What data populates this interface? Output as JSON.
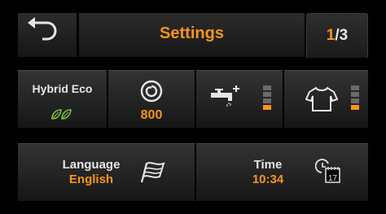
{
  "header": {
    "title": "Settings",
    "page_current": "1",
    "page_separator": "/",
    "page_total": "3"
  },
  "tiles": {
    "program": {
      "label": "Hybrid Eco",
      "icon": "leaf-icon",
      "accent": "#7bc043"
    },
    "spin": {
      "value": "800",
      "icon": "spin-swirl-icon"
    },
    "water": {
      "icon": "faucet-plus-icon",
      "level_active": 1,
      "level_total": 3
    },
    "soil": {
      "icon": "shirt-icon",
      "level_active": 1,
      "level_total": 3
    },
    "language": {
      "label": "Language",
      "value": "English",
      "icon": "flag-icon"
    },
    "time": {
      "label": "Time",
      "value": "10:34",
      "icon": "clock-calendar-icon",
      "calendar_day": "17"
    }
  },
  "colors": {
    "accent": "#f7941d",
    "text": "#e6e6e6",
    "background": "#000000"
  }
}
